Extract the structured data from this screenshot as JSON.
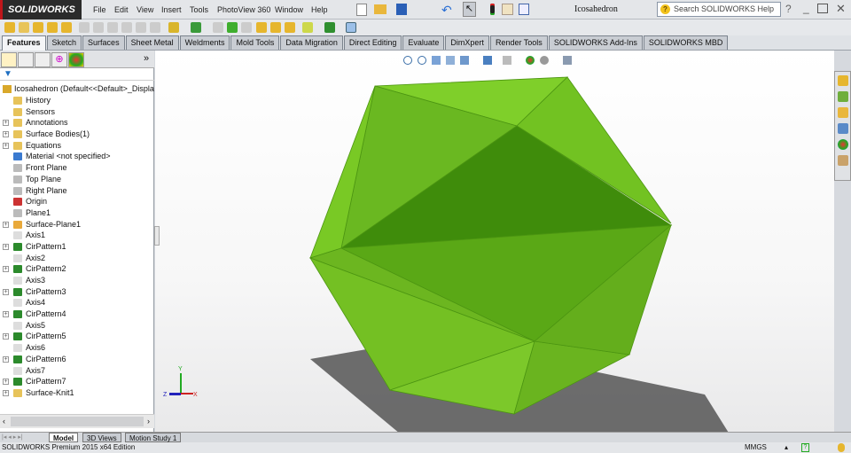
{
  "app": {
    "logo": "SOLIDWORKS",
    "document_title": "Icosahedron",
    "search_placeholder": "Search SOLIDWORKS Help"
  },
  "menu": [
    "File",
    "Edit",
    "View",
    "Insert",
    "Tools",
    "PhotoView 360",
    "Window",
    "Help"
  ],
  "tabs": [
    {
      "label": "Features",
      "active": true
    },
    {
      "label": "Sketch"
    },
    {
      "label": "Surfaces"
    },
    {
      "label": "Sheet Metal"
    },
    {
      "label": "Weldments"
    },
    {
      "label": "Mold Tools"
    },
    {
      "label": "Data Migration"
    },
    {
      "label": "Direct Editing"
    },
    {
      "label": "Evaluate"
    },
    {
      "label": "DimXpert"
    },
    {
      "label": "Render Tools"
    },
    {
      "label": "SOLIDWORKS Add-Ins"
    },
    {
      "label": "SOLIDWORKS MBD"
    }
  ],
  "tree": {
    "root": "Icosahedron  (Default<<Default>_Display S",
    "items": [
      {
        "label": "History",
        "icon": "history-icon",
        "color": "#e7c35a"
      },
      {
        "label": "Sensors",
        "icon": "sensors-icon",
        "color": "#e7c35a"
      },
      {
        "label": "Annotations",
        "icon": "annotations-icon",
        "color": "#e7c35a",
        "expand": true
      },
      {
        "label": "Surface Bodies(1)",
        "icon": "surface-bodies-icon",
        "color": "#e7c35a",
        "expand": true
      },
      {
        "label": "Equations",
        "icon": "equations-icon",
        "color": "#e7c35a",
        "expand": true
      },
      {
        "label": "Material <not specified>",
        "icon": "material-icon",
        "color": "#3a7ad0"
      },
      {
        "label": "Front Plane",
        "icon": "plane-icon",
        "color": "#bbb"
      },
      {
        "label": "Top Plane",
        "icon": "plane-icon",
        "color": "#bbb"
      },
      {
        "label": "Right Plane",
        "icon": "plane-icon",
        "color": "#bbb"
      },
      {
        "label": "Origin",
        "icon": "origin-icon",
        "color": "#c33"
      },
      {
        "label": "Plane1",
        "icon": "plane-icon",
        "color": "#bbb"
      },
      {
        "label": "Surface-Plane1",
        "icon": "surface-plane-icon",
        "color": "#e9a93a",
        "expand": true
      },
      {
        "label": "Axis1",
        "icon": "axis-icon",
        "color": "#ddd"
      },
      {
        "label": "CirPattern1",
        "icon": "circular-pattern-icon",
        "color": "#2c8a2c",
        "expand": true
      },
      {
        "label": "Axis2",
        "icon": "axis-icon",
        "color": "#ddd"
      },
      {
        "label": "CirPattern2",
        "icon": "circular-pattern-icon",
        "color": "#2c8a2c",
        "expand": true
      },
      {
        "label": "Axis3",
        "icon": "axis-icon",
        "color": "#ddd"
      },
      {
        "label": "CirPattern3",
        "icon": "circular-pattern-icon",
        "color": "#2c8a2c",
        "expand": true
      },
      {
        "label": "Axis4",
        "icon": "axis-icon",
        "color": "#ddd"
      },
      {
        "label": "CirPattern4",
        "icon": "circular-pattern-icon",
        "color": "#2c8a2c",
        "expand": true
      },
      {
        "label": "Axis5",
        "icon": "axis-icon",
        "color": "#ddd"
      },
      {
        "label": "CirPattern5",
        "icon": "circular-pattern-icon",
        "color": "#2c8a2c",
        "expand": true
      },
      {
        "label": "Axis6",
        "icon": "axis-icon",
        "color": "#ddd"
      },
      {
        "label": "CirPattern6",
        "icon": "circular-pattern-icon",
        "color": "#2c8a2c",
        "expand": true
      },
      {
        "label": "Axis7",
        "icon": "axis-icon",
        "color": "#ddd"
      },
      {
        "label": "CirPattern7",
        "icon": "circular-pattern-icon",
        "color": "#2c8a2c",
        "expand": true
      },
      {
        "label": "Surface-Knit1",
        "icon": "surface-knit-icon",
        "color": "#e7c35a",
        "expand": true
      }
    ]
  },
  "bottom_tabs": [
    {
      "label": "Model",
      "active": true
    },
    {
      "label": "3D Views"
    },
    {
      "label": "Motion Study 1"
    }
  ],
  "status": {
    "edition": "SOLIDWORKS Premium 2015 x64 Edition",
    "units": "MMGS"
  },
  "triad": {
    "x": "X",
    "y": "Y",
    "z": "Z"
  },
  "colors": {
    "model": "#74c21f",
    "model_dark": "#3f8a0a",
    "accent": "#c0161b"
  }
}
